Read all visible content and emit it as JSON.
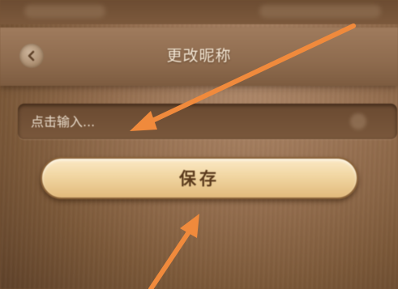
{
  "header": {
    "title": "更改昵称",
    "back_icon": "chevron-left-icon"
  },
  "form": {
    "nickname_placeholder": "点击输入...",
    "nickname_value": "",
    "save_label": "保存"
  },
  "colors": {
    "background": "#8e6b4e",
    "title_text": "#f6ead8",
    "button_fill": "#f1d6a2",
    "button_text": "#5a3a1c",
    "annotation_arrow": "#f08a3c"
  }
}
